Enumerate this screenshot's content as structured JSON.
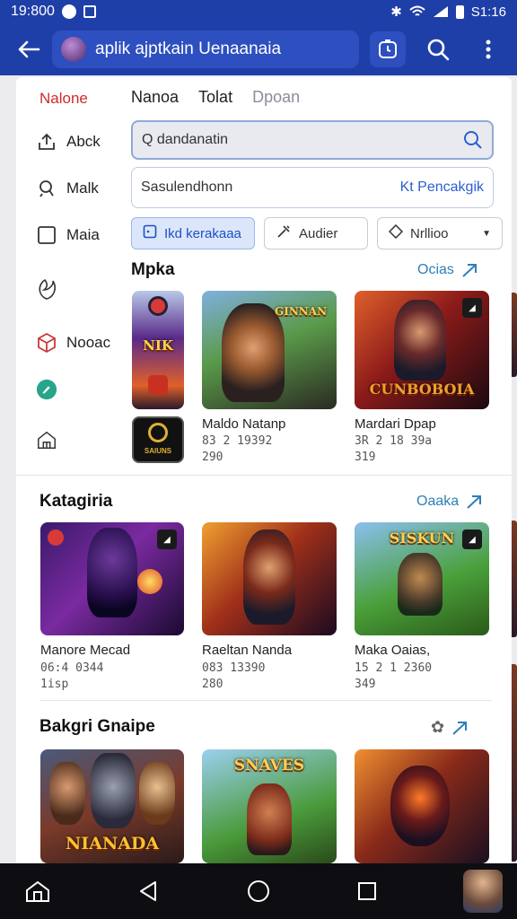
{
  "status_bar": {
    "time": "19:800",
    "clock": "S1:16"
  },
  "app_bar": {
    "title": "aplik ajptkain Uenaanaia"
  },
  "rail": {
    "header": "Nalone",
    "items": [
      {
        "label": "Abck",
        "icon": "upload-icon"
      },
      {
        "label": "Malk",
        "icon": "pin-icon"
      },
      {
        "label": "Maia",
        "icon": "checkbox-icon"
      },
      {
        "label": "",
        "icon": "leaf-icon"
      },
      {
        "label": "Nooac",
        "icon": "cube-icon"
      },
      {
        "label": "",
        "icon": "edit-icon"
      },
      {
        "label": "",
        "icon": "house-icon"
      }
    ]
  },
  "tabs": [
    {
      "label": "Nanoa"
    },
    {
      "label": "Tolat"
    },
    {
      "label": "Dpoan"
    }
  ],
  "search": {
    "placeholder": "Q dandanatin"
  },
  "filter_field": {
    "value": "Sasulendhonn",
    "link": "Kt Pencakgik"
  },
  "chips": [
    {
      "label": "Ikd kerakaaa"
    },
    {
      "label": "Audier"
    },
    {
      "label": "Nrllioo"
    }
  ],
  "sections": [
    {
      "title": "Mpka",
      "link": "Ocias",
      "items": [
        {
          "title": "",
          "line1": "",
          "line2": "",
          "art": "NIK"
        },
        {
          "title": "Maldo Natanp",
          "line1": "83 2 19392",
          "line2": "290",
          "art": "GINNAN"
        },
        {
          "title": "Mardari Dpap",
          "line1": "3R 2 18 39a",
          "line2": "319",
          "art": "CUNBOBOIA"
        }
      ],
      "mini_label": "SAIUNS"
    },
    {
      "title": "Katagiria",
      "link": "Oaaka",
      "items": [
        {
          "title": "Manore Mecad",
          "line1": "06:4 0344",
          "line2": "1isp",
          "art": ""
        },
        {
          "title": "Raeltan Nanda",
          "line1": "083 13390",
          "line2": "280",
          "art": ""
        },
        {
          "title": "Maka Oaias,",
          "line1": "15 2 1 2360",
          "line2": "349",
          "art": "SISKUN"
        }
      ]
    },
    {
      "title": "Bakgri Gnaipe",
      "link": "",
      "items": [
        {
          "title": "",
          "line1": "",
          "line2": "",
          "art": "NIANADA"
        },
        {
          "title": "",
          "line1": "",
          "line2": "",
          "art": "SNAVES"
        },
        {
          "title": "",
          "line1": "",
          "line2": "",
          "art": ""
        }
      ]
    }
  ],
  "colors": {
    "primary": "#1f3fa8",
    "accent": "#2b5fd0",
    "rail_header": "#d02a2a",
    "link": "#2f7fb8"
  }
}
